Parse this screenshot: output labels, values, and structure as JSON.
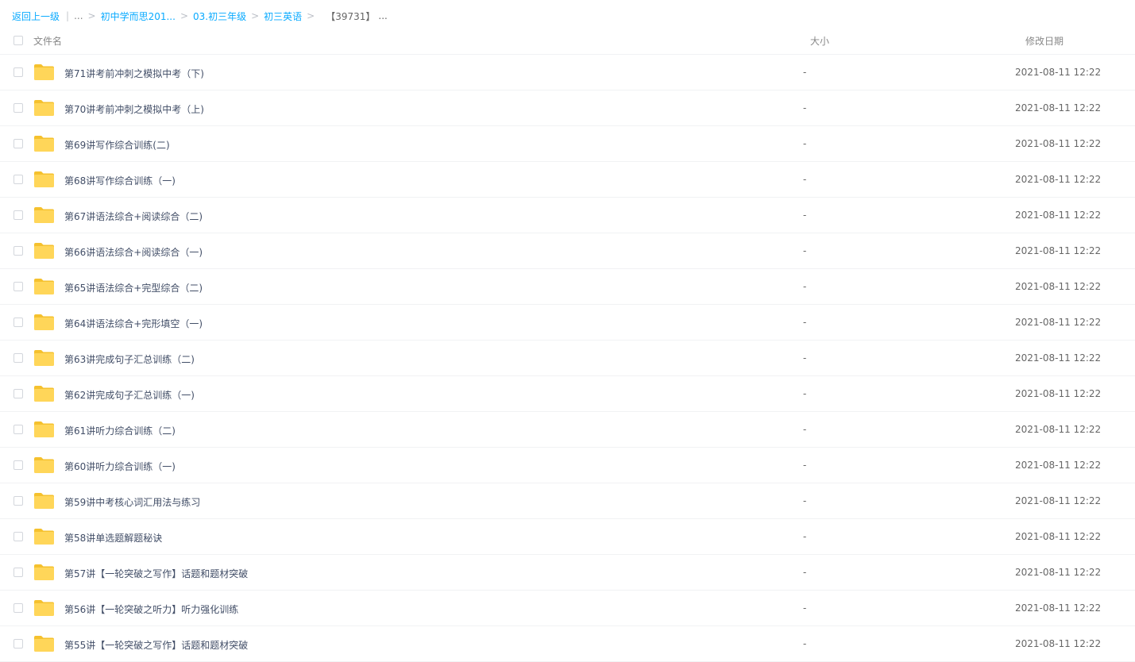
{
  "breadcrumb": {
    "back": "返回上一级",
    "ellipsis": "...",
    "items": [
      "初中学而思201...",
      "03.初三年级",
      "初三英语"
    ],
    "current": "【39731】",
    "current_ellipsis": "..."
  },
  "columns": {
    "name": "文件名",
    "size": "大小",
    "date": "修改日期"
  },
  "colors": {
    "link": "#09aaff",
    "folder": "#ffd659",
    "folder_back": "#f5c12e"
  },
  "rows": [
    {
      "name": "第71讲考前冲刺之模拟中考（下)",
      "size": "-",
      "date": "2021-08-11 12:22",
      "icon": "folder-icon"
    },
    {
      "name": "第70讲考前冲刺之模拟中考（上)",
      "size": "-",
      "date": "2021-08-11 12:22",
      "icon": "folder-icon"
    },
    {
      "name": "第69讲写作综合训练(二)",
      "size": "-",
      "date": "2021-08-11 12:22",
      "icon": "folder-icon"
    },
    {
      "name": "第68讲写作综合训练（一)",
      "size": "-",
      "date": "2021-08-11 12:22",
      "icon": "folder-icon"
    },
    {
      "name": "第67讲语法综合+阅读综合（二)",
      "size": "-",
      "date": "2021-08-11 12:22",
      "icon": "folder-icon"
    },
    {
      "name": "第66讲语法综合+阅读综合（一)",
      "size": "-",
      "date": "2021-08-11 12:22",
      "icon": "folder-icon"
    },
    {
      "name": "第65讲语法综合+完型综合（二)",
      "size": "-",
      "date": "2021-08-11 12:22",
      "icon": "folder-icon"
    },
    {
      "name": "第64讲语法综合+完形填空（一)",
      "size": "-",
      "date": "2021-08-11 12:22",
      "icon": "folder-icon"
    },
    {
      "name": "第63讲完成句子汇总训练（二)",
      "size": "-",
      "date": "2021-08-11 12:22",
      "icon": "folder-icon"
    },
    {
      "name": "第62讲完成句子汇总训练（一)",
      "size": "-",
      "date": "2021-08-11 12:22",
      "icon": "folder-icon"
    },
    {
      "name": "第61讲听力综合训练（二)",
      "size": "-",
      "date": "2021-08-11 12:22",
      "icon": "folder-icon"
    },
    {
      "name": "第60讲听力综合训练（一)",
      "size": "-",
      "date": "2021-08-11 12:22",
      "icon": "folder-icon"
    },
    {
      "name": "第59讲中考核心词汇用法与练习",
      "size": "-",
      "date": "2021-08-11 12:22",
      "icon": "folder-icon"
    },
    {
      "name": "第58讲单选题解题秘诀",
      "size": "-",
      "date": "2021-08-11 12:22",
      "icon": "folder-icon"
    },
    {
      "name": "第57讲【一轮突破之写作】话题和题材突破",
      "size": "-",
      "date": "2021-08-11 12:22",
      "icon": "folder-icon"
    },
    {
      "name": "第56讲【一轮突破之听力】听力强化训练",
      "size": "-",
      "date": "2021-08-11 12:22",
      "icon": "folder-icon"
    },
    {
      "name": "第55讲【一轮突破之写作】话题和题材突破",
      "size": "-",
      "date": "2021-08-11 12:22",
      "icon": "folder-icon"
    }
  ]
}
